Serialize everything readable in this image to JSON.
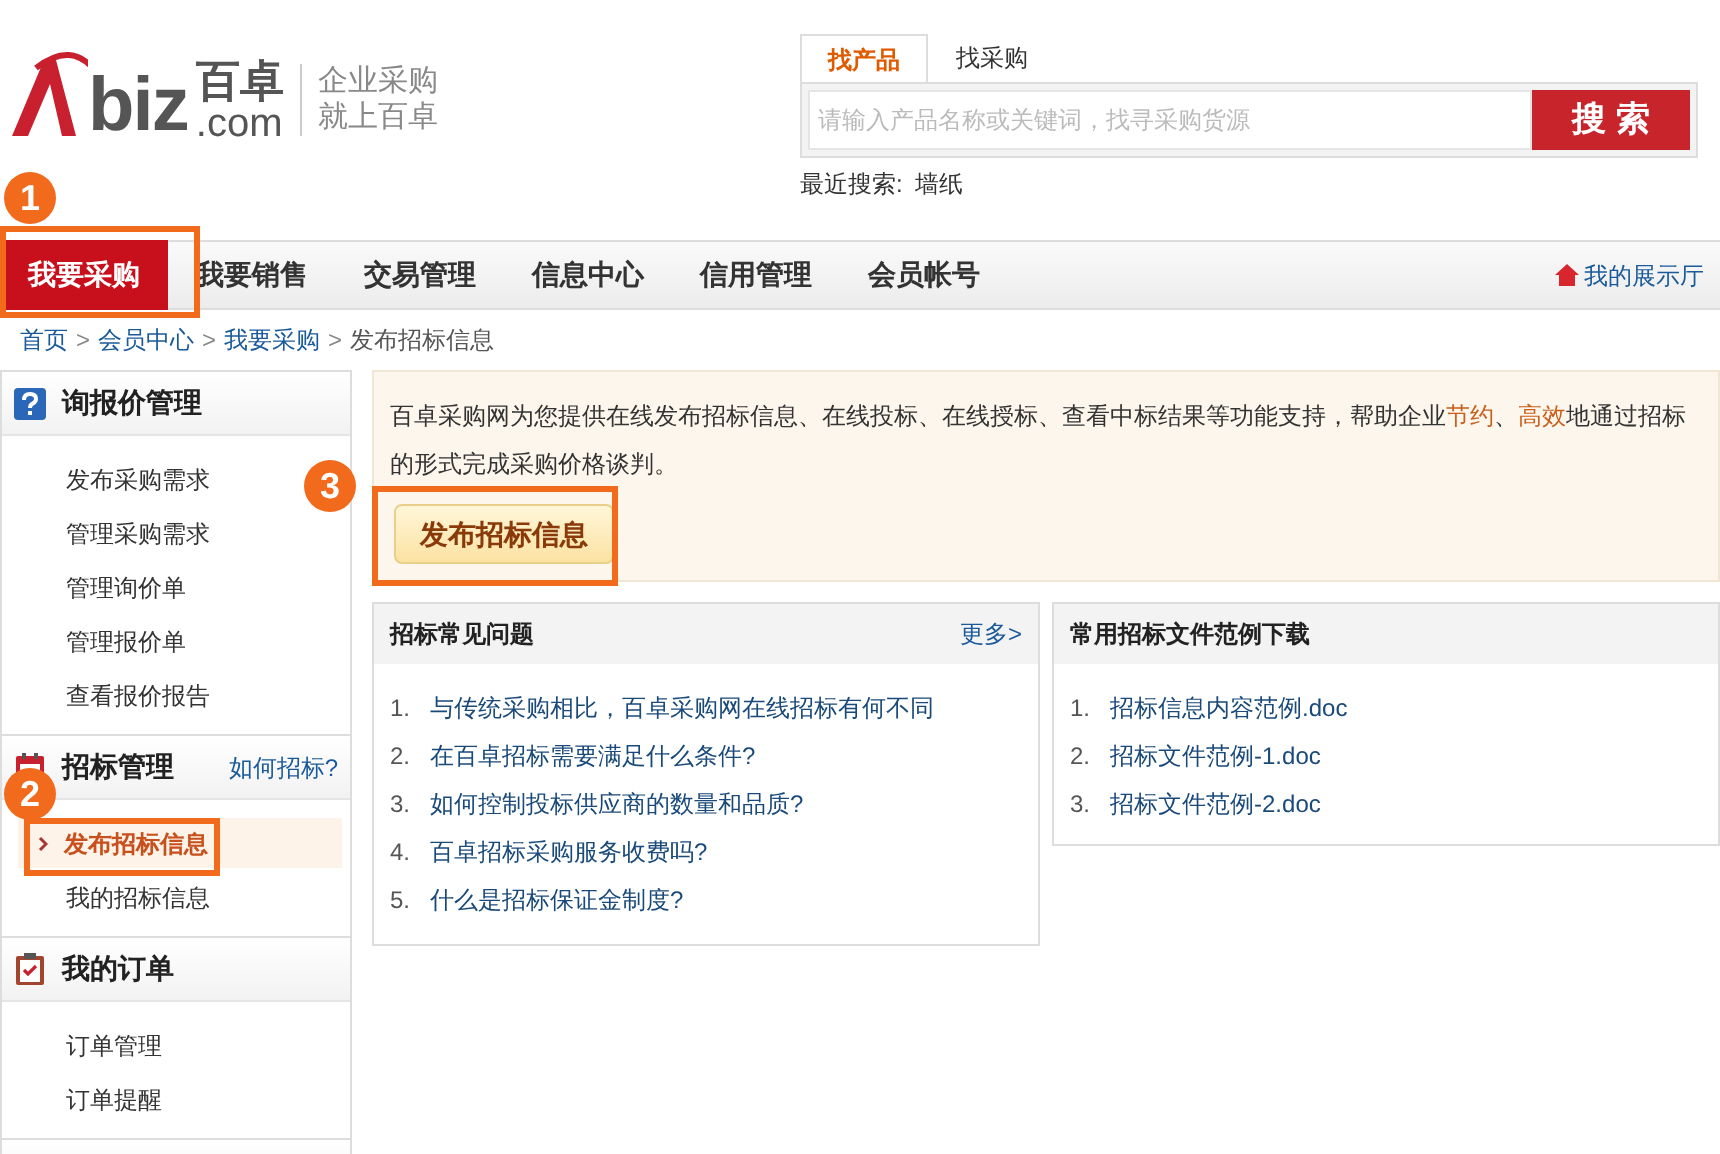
{
  "logo": {
    "mark": "biz",
    "name": "百卓",
    "domain": ".com",
    "slogan": [
      "企业采购",
      "就上百卓"
    ]
  },
  "search": {
    "tabs": [
      {
        "label": "找产品",
        "selected": true
      },
      {
        "label": "找采购",
        "selected": false
      }
    ],
    "placeholder": "请输入产品名称或关键词，找寻采购货源",
    "button": "搜 索",
    "recent_label": "最近搜索:",
    "recent": [
      "墙纸"
    ]
  },
  "nav": {
    "items": [
      {
        "label": "我要采购",
        "selected": true
      },
      {
        "label": "我要销售",
        "selected": false
      },
      {
        "label": "交易管理",
        "selected": false
      },
      {
        "label": "信息中心",
        "selected": false
      },
      {
        "label": "信用管理",
        "selected": false
      },
      {
        "label": "会员帐号",
        "selected": false
      }
    ],
    "showroom": "我的展示厅"
  },
  "breadcrumb": {
    "separator": ">",
    "items": [
      "首页",
      "会员中心",
      "我要采购",
      "发布招标信息"
    ]
  },
  "sidebar": {
    "sections": [
      {
        "title": "询报价管理",
        "items": [
          {
            "label": "发布采购需求",
            "selected": false
          },
          {
            "label": "管理采购需求",
            "selected": false
          },
          {
            "label": "管理询价单",
            "selected": false
          },
          {
            "label": "管理报价单",
            "selected": false
          },
          {
            "label": "查看报价报告",
            "selected": false
          }
        ]
      },
      {
        "title": "招标管理",
        "link": "如何招标?",
        "items": [
          {
            "label": "发布招标信息",
            "selected": true
          },
          {
            "label": "我的招标信息",
            "selected": false
          }
        ]
      },
      {
        "title": "我的订单",
        "items": [
          {
            "label": "订单管理",
            "selected": false
          },
          {
            "label": "订单提醒",
            "selected": false
          }
        ]
      }
    ]
  },
  "intro": {
    "segments": [
      {
        "text": "百卓采购网为您提供在线发布招标信息、在线投标、在线授标、查看中标结果等功能支持，帮助企业",
        "highlight": false
      },
      {
        "text": "节约",
        "highlight": true
      },
      {
        "text": "、",
        "highlight": false
      },
      {
        "text": "高效",
        "highlight": true
      },
      {
        "text": "地通过招标的形式完成采购价格谈判。",
        "highlight": false
      }
    ],
    "button": "发布招标信息"
  },
  "faq": {
    "title": "招标常见问题",
    "more": "更多>",
    "items": [
      {
        "number": "1.",
        "text": "与传统采购相比，百卓采购网在线招标有何不同"
      },
      {
        "number": "2.",
        "text": "在百卓招标需要满足什么条件?"
      },
      {
        "number": "3.",
        "text": "如何控制投标供应商的数量和品质?"
      },
      {
        "number": "4.",
        "text": "百卓招标采购服务收费吗?"
      },
      {
        "number": "5.",
        "text": "什么是招标保证金制度?"
      }
    ]
  },
  "downloads": {
    "title": "常用招标文件范例下载",
    "items": [
      {
        "number": "1.",
        "text": "招标信息内容范例.doc"
      },
      {
        "number": "2.",
        "text": "招标文件范例-1.doc"
      },
      {
        "number": "3.",
        "text": "招标文件范例-2.doc"
      }
    ]
  },
  "callouts": [
    "1",
    "2",
    "3"
  ]
}
